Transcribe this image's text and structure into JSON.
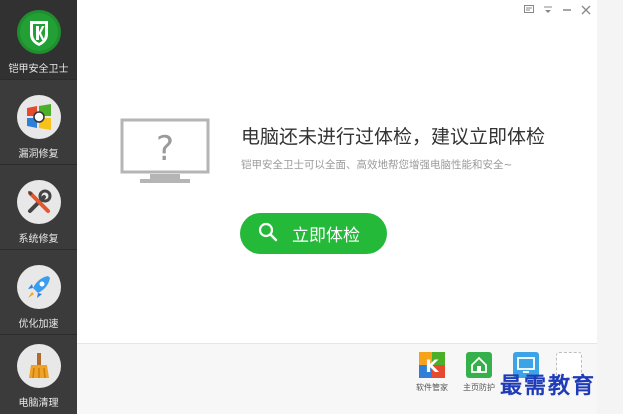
{
  "sidebar": {
    "items": [
      {
        "label": "铠甲安全卫士",
        "icon": "shield-k-logo-icon"
      },
      {
        "label": "漏洞修复",
        "icon": "windows-repair-icon"
      },
      {
        "label": "系统修复",
        "icon": "wrench-screwdriver-icon"
      },
      {
        "label": "优化加速",
        "icon": "rocket-icon"
      },
      {
        "label": "电脑清理",
        "icon": "broom-icon"
      }
    ]
  },
  "window_controls": [
    "menu-icon",
    "dropdown-icon",
    "minimize-icon",
    "close-icon"
  ],
  "main": {
    "monitor_symbol": "?",
    "headline": "电脑还未进行过体检，建议立即体检",
    "subline": "铠甲安全卫士可以全面、高效地帮您增强电脑性能和安全~",
    "scan_button": "立即体检"
  },
  "tools": [
    {
      "label": "软件管家",
      "letter": "K"
    },
    {
      "label": "主页防护",
      "letter": ""
    },
    {
      "label": "",
      "letter": ""
    },
    {
      "label": "",
      "letter": ""
    }
  ],
  "watermark": "最需教育",
  "colors": {
    "sidebar": "#3b3b3b",
    "accent_green": "#25b93a",
    "text_dark": "#333333",
    "text_gray": "#9a9a9a"
  }
}
